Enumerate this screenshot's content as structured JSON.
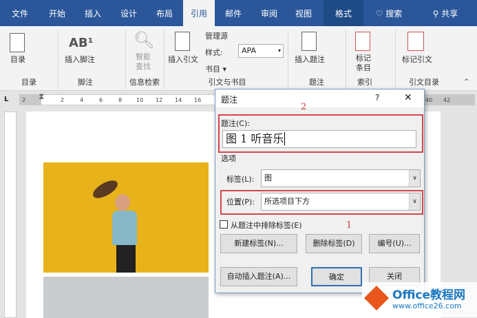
{
  "tabs": [
    "文件",
    "开始",
    "插入",
    "设计",
    "布局",
    "引用",
    "邮件",
    "审阅",
    "视图",
    "格式"
  ],
  "search": "搜索",
  "share": "共享",
  "ribbon": {
    "toc": "目录",
    "toc_group": "目录",
    "insert_footnote": "插入脚注",
    "footnote_group": "脚注",
    "smart_lookup_1": "智能",
    "smart_lookup_2": "查找",
    "research_group": "信息检索",
    "insert_citation": "插入引文",
    "manage_sources": "管理源",
    "style_label": "样式:",
    "style_value": "APA",
    "bibliography": "书目",
    "citation_group": "引文与书目",
    "insert_caption": "插入题注",
    "caption_group": "题注",
    "mark_entry_1": "标记",
    "mark_entry_2": "条目",
    "index_group": "索引",
    "mark_citation": "标记引文",
    "toa_group": "引文目录"
  },
  "ruler": {
    "left": [
      "2",
      "2",
      "4",
      "6",
      "8",
      "10",
      "12",
      "14",
      "16"
    ],
    "right": [
      "40",
      "42"
    ]
  },
  "dialog": {
    "title": "题注",
    "help": "?",
    "close": "✕",
    "caption_label": "题注(C):",
    "caption_value": "图 1 听音乐",
    "options": "选项",
    "label_label": "标签(L):",
    "label_value": "图",
    "position_label": "位置(P):",
    "position_value": "所选项目下方",
    "exclude_label": "从题注中排除标签(E)",
    "new_label": "新建标签(N)...",
    "delete_label": "删除标签(D)",
    "numbering": "编号(U)...",
    "autocaption": "自动插入题注(A)...",
    "ok": "确定",
    "close_btn": "关闭",
    "annotation_1": "1",
    "annotation_2": "2"
  },
  "watermark": {
    "brand": "Office教程网",
    "url": "www.office26.com"
  },
  "colors": {
    "ribbon_blue": "#2b579a",
    "annotation_red": "#d2474f",
    "photo_yellow": "#e8b21a"
  }
}
